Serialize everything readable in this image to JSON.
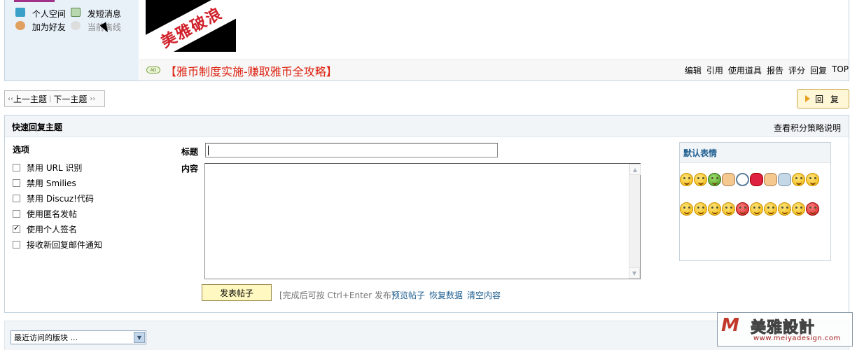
{
  "user_panel": {
    "personal_space": "个人空间",
    "send_message": "发短消息",
    "add_friend": "加为好友",
    "online_status": "当前离线"
  },
  "signature_image_text": "美雅破浪",
  "post": {
    "ad_tag": "AD",
    "ad_link": "【雅币制度实施-赚取雅币全攻略】",
    "actions": [
      "编辑",
      "引用",
      "使用道具",
      "报告",
      "评分",
      "回复",
      "TOP"
    ]
  },
  "thread_nav": {
    "prev": "上一主题",
    "next": "下一主题",
    "prev_arrows": "‹‹",
    "next_arrows": "››"
  },
  "reply_button": "回 复",
  "quick_reply": {
    "title": "快速回复主题",
    "strategy_link": "查看积分策略说明",
    "options_title": "选项",
    "options": [
      {
        "label": "禁用 URL 识别",
        "checked": false
      },
      {
        "label": "禁用 Smilies",
        "checked": false
      },
      {
        "label": "禁用 Discuz!代码",
        "checked": false
      },
      {
        "label": "使用匿名发帖",
        "checked": false
      },
      {
        "label": "使用个人签名",
        "checked": true
      },
      {
        "label": "接收新回复邮件通知",
        "checked": false
      }
    ],
    "subject_label": "标题",
    "subject_value": "",
    "content_label": "内容",
    "content_value": "",
    "submit": "发表帖子",
    "hint": "[完成后可按 Ctrl+Enter 发布]",
    "preview": "预览帖子",
    "restore": "恢复数据",
    "clear": "清空内容"
  },
  "emoticons": {
    "title": "默认表情",
    "row1": [
      "smile",
      "grin",
      "frog",
      "victory",
      "clock",
      "lips",
      "handshake",
      "phone",
      "smile2",
      "laugh"
    ],
    "row2": [
      "tongue",
      "sad",
      "wink",
      "cry",
      "angry",
      "shy",
      "surprised",
      "kiss",
      "sleepy",
      "shocked"
    ]
  },
  "bottom": {
    "recent_forums": "最近访问的版块 ..."
  },
  "watermark": {
    "logo_text": "美雅設計",
    "url": "www.meiyadesign.com"
  }
}
